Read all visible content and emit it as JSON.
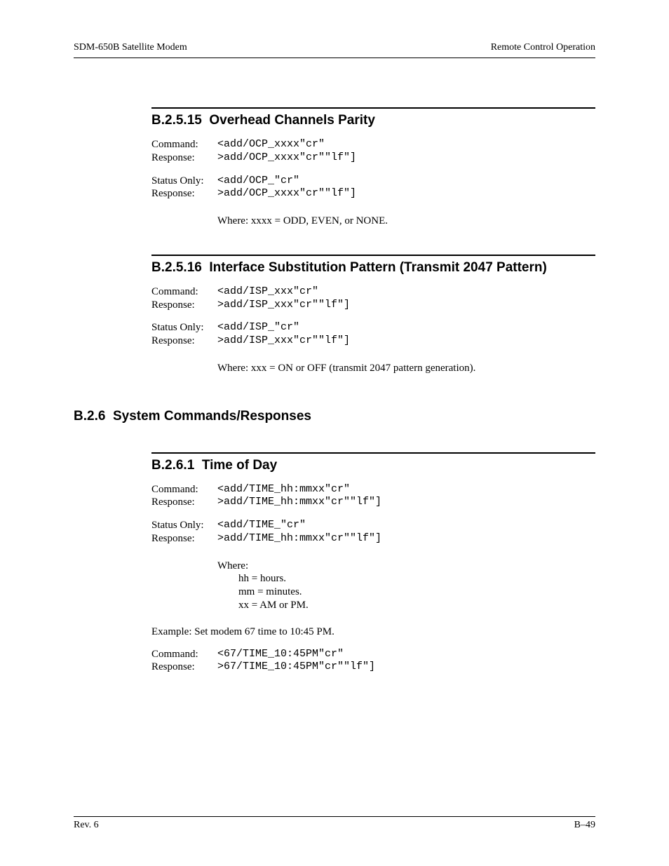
{
  "header": {
    "left": "SDM-650B Satellite Modem",
    "right": "Remote Control Operation"
  },
  "s1": {
    "num": "B.2.5.15",
    "title": "Overhead Channels Parity",
    "rows": {
      "cmd_lbl": "Command:",
      "cmd_val": "<add/OCP_xxxx\"cr\"",
      "rsp_lbl": "Response:",
      "rsp_val": ">add/OCP_xxxx\"cr\"\"lf\"]",
      "so_lbl": "Status Only:",
      "so_val": "<add/OCP_\"cr\"",
      "rsp2_lbl": "Response:",
      "rsp2_val": ">add/OCP_xxxx\"cr\"\"lf\"]"
    },
    "where": "Where: xxxx = ODD, EVEN, or NONE."
  },
  "s2": {
    "num": "B.2.5.16",
    "title": "Interface Substitution Pattern (Transmit 2047 Pattern)",
    "rows": {
      "cmd_lbl": "Command:",
      "cmd_val": "<add/ISP_xxx\"cr\"",
      "rsp_lbl": "Response:",
      "rsp_val": ">add/ISP_xxx\"cr\"\"lf\"]",
      "so_lbl": "Status Only:",
      "so_val": "<add/ISP_\"cr\"",
      "rsp2_lbl": "Response:",
      "rsp2_val": ">add/ISP_xxx\"cr\"\"lf\"]"
    },
    "where": "Where: xxx = ON or OFF (transmit 2047 pattern generation)."
  },
  "major": {
    "num": "B.2.6",
    "title": "System Commands/Responses"
  },
  "s3": {
    "num": "B.2.6.1",
    "title": "Time of Day",
    "rows": {
      "cmd_lbl": "Command:",
      "cmd_val": "<add/TIME_hh:mmxx\"cr\"",
      "rsp_lbl": "Response:",
      "rsp_val": ">add/TIME_hh:mmxx\"cr\"\"lf\"]",
      "so_lbl": "Status Only:",
      "so_val": "<add/TIME_\"cr\"",
      "rsp2_lbl": "Response:",
      "rsp2_val": ">add/TIME_hh:mmxx\"cr\"\"lf\"]"
    },
    "where_intro": "Where:",
    "where_lines": {
      "a": "hh = hours.",
      "b": "mm = minutes.",
      "c": "xx = AM or PM."
    },
    "example": "Example: Set modem 67 time to 10:45 PM.",
    "ex_rows": {
      "cmd_lbl": "Command:",
      "cmd_val": "<67/TIME_10:45PM\"cr\"",
      "rsp_lbl": "Response:",
      "rsp_val": ">67/TIME_10:45PM\"cr\"\"lf\"]"
    }
  },
  "footer": {
    "left": "Rev. 6",
    "right": "B–49"
  }
}
